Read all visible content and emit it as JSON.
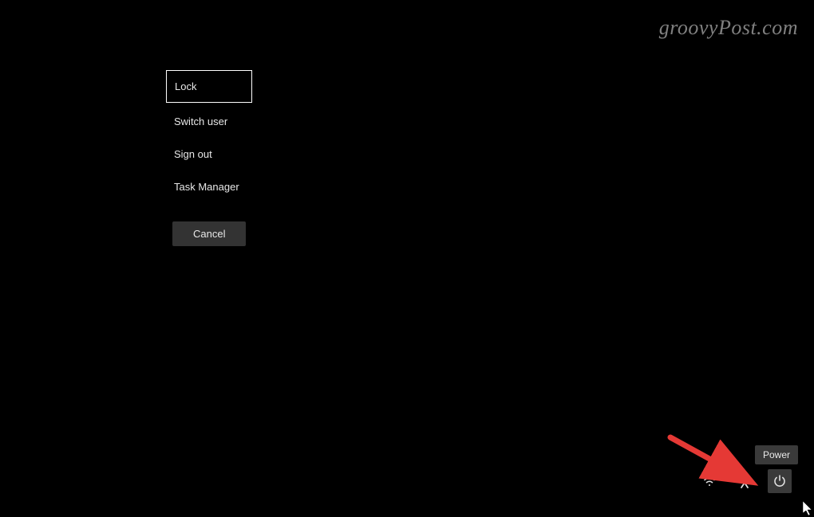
{
  "watermark": "groovyPost.com",
  "menu": {
    "items": [
      {
        "label": "Lock",
        "selected": true
      },
      {
        "label": "Switch user",
        "selected": false
      },
      {
        "label": "Sign out",
        "selected": false
      },
      {
        "label": "Task Manager",
        "selected": false
      }
    ],
    "cancel_label": "Cancel"
  },
  "tooltip": {
    "power_label": "Power"
  },
  "icons": {
    "wifi": "wifi-icon",
    "accessibility": "accessibility-icon",
    "power": "power-icon"
  },
  "annotation": {
    "arrow_color": "#e53935"
  }
}
